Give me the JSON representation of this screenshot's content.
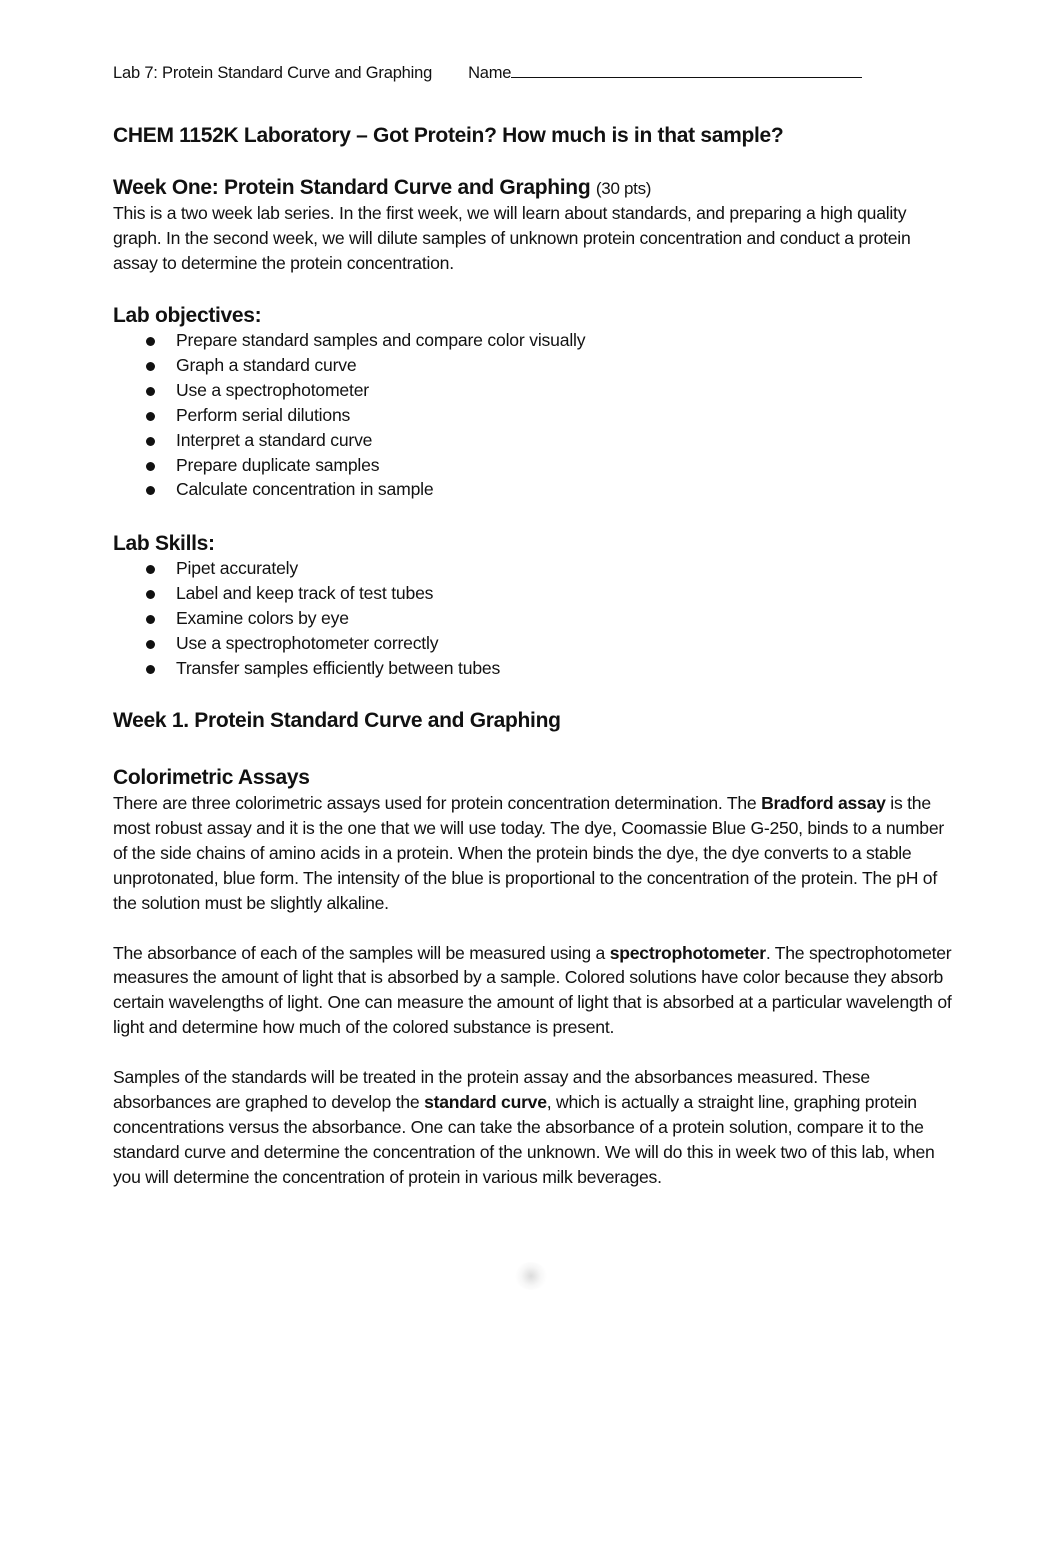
{
  "header": {
    "lab_title": "Lab 7: Protein Standard Curve and Graphing",
    "name_label": "Name"
  },
  "title": "CHEM 1152K Laboratory – Got Protein? How much is in that sample?",
  "week_one": {
    "heading": "Week One: Protein Standard Curve and Graphing",
    "points": "(30 pts)",
    "intro": "This is a two week lab series. In the first week, we will learn about standards, and preparing a high quality graph. In the second week, we will dilute samples of unknown protein concentration and conduct a protein assay to determine the protein concentration."
  },
  "objectives": {
    "heading": "Lab objectives:",
    "items": [
      "Prepare standard samples and compare color visually",
      "Graph a standard curve",
      "Use a spectrophotometer",
      "Perform serial dilutions",
      "Interpret a standard curve",
      "Prepare duplicate samples",
      "Calculate concentration in sample"
    ]
  },
  "skills": {
    "heading": "Lab Skills:",
    "items": [
      "Pipet accurately",
      "Label and keep track of test tubes",
      "Examine colors by eye",
      "Use a spectrophotometer correctly",
      "Transfer samples efficiently between tubes"
    ]
  },
  "week1_heading": "Week 1. Protein Standard Curve and Graphing",
  "colorimetric": {
    "heading": "Colorimetric Assays",
    "p1": {
      "before": "There are three colorimetric assays used for protein concentration determination. The ",
      "bold": "Bradford assay",
      "after": " is the most robust assay and it is the one that we will use today. The dye, Coomassie Blue G-250, binds to a number of the side chains of amino acids in a protein. When the protein binds the dye, the dye converts to a stable unprotonated, blue form. The intensity of the blue is proportional to the concentration of the protein. The pH of the solution must be slightly alkaline."
    },
    "p2": {
      "before": "The absorbance of each of the samples will be measured using a ",
      "bold": "spectrophotometer",
      "after": ". The spectrophotometer measures the amount of light that is absorbed by a sample. Colored solutions have color because they absorb certain wavelengths of light. One can measure the amount of light that is absorbed at a particular wavelength of light and determine how much of the colored substance is present."
    },
    "p3": {
      "before": "Samples of the standards will be treated in the protein assay and the absorbances measured. These absorbances are graphed to develop the ",
      "bold": "standard curve",
      "after": ", which is actually a straight line, graphing protein concentrations versus the absorbance. One can take the absorbance of a protein solution, compare it to the standard curve and determine the concentration of the unknown. We will do this in week two of this lab, when you will determine the concentration of protein in various milk beverages."
    }
  }
}
